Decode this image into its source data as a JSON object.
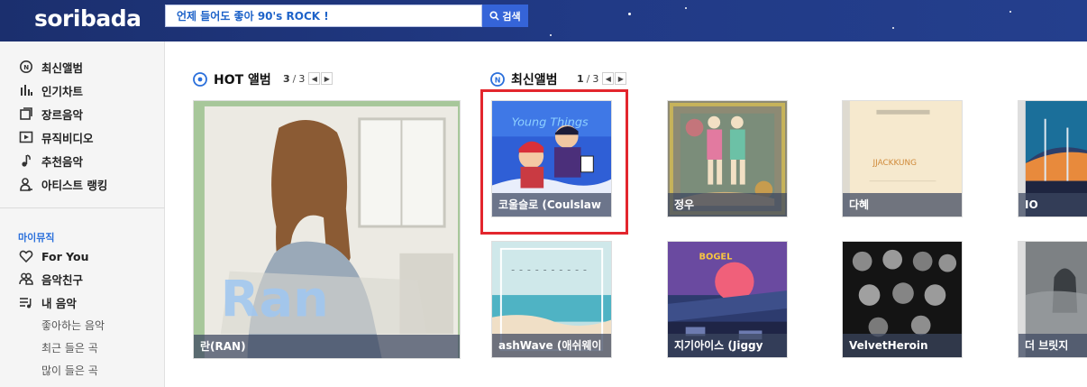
{
  "header": {
    "logo": "soribada",
    "search_placeholder": "언제 들어도 좋아 90's ROCK !",
    "search_button": "검색"
  },
  "sidebar": {
    "nav": [
      {
        "label": "최신앨범",
        "icon": "new-album-icon"
      },
      {
        "label": "인기차트",
        "icon": "chart-bars-icon"
      },
      {
        "label": "장르음악",
        "icon": "genre-icon"
      },
      {
        "label": "뮤직비디오",
        "icon": "music-video-icon"
      },
      {
        "label": "추천음악",
        "icon": "music-note-icon"
      },
      {
        "label": "아티스트 랭킹",
        "icon": "artist-ranking-icon"
      }
    ],
    "mymusic_label": "마이뮤직",
    "mymusic_nav": [
      {
        "label": "For You",
        "icon": "heart-icon"
      },
      {
        "label": "음악친구",
        "icon": "friends-icon"
      },
      {
        "label": "내 음악",
        "icon": "playlist-icon"
      }
    ],
    "sub_items": [
      "좋아하는 음악",
      "최근 들은 곡",
      "많이 들은 곡"
    ]
  },
  "hot": {
    "title": "HOT 앨범",
    "page_current": "3",
    "page_sep": "/",
    "page_total": "3",
    "albums": [
      {
        "caption": "란(RAN)"
      }
    ]
  },
  "latest": {
    "title": "최신앨범",
    "page_current": "1",
    "page_sep": "/",
    "page_total": "3",
    "albums": [
      {
        "caption": "코울슬로 (Coulslaw"
      },
      {
        "caption": "정우"
      },
      {
        "caption": "다혜"
      },
      {
        "caption": "IO"
      },
      {
        "caption": "ashWave (애쉬웨이"
      },
      {
        "caption": "지기아이스 (Jiggy"
      },
      {
        "caption": "VelvetHeroin"
      },
      {
        "caption": "더 브릿지"
      }
    ]
  },
  "colors": {
    "header_bg": "#213a86",
    "accent_blue": "#3564d8",
    "highlight_red": "#e3262d"
  }
}
